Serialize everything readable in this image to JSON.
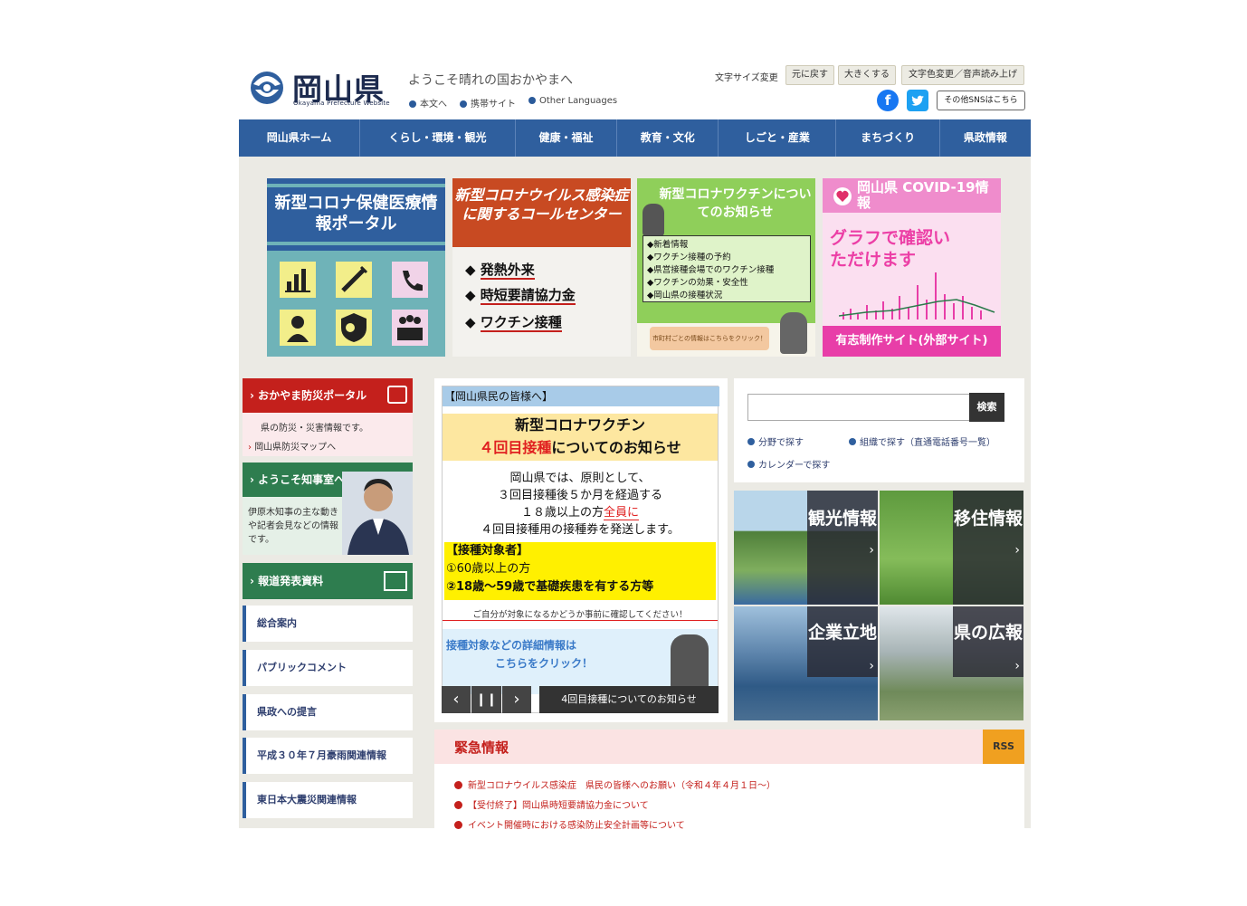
{
  "header": {
    "logo_text": "岡山県",
    "logo_sub": "Okayama Prefecture Website",
    "tagline": "ようこそ晴れの国おかやまへ",
    "links": [
      "本文へ",
      "携帯サイト",
      "Other Languages"
    ],
    "font_size_label": "文字サイズ変更",
    "font_reset": "元に戻す",
    "font_bigger": "大きくする",
    "color_voice": "文字色変更／音声読み上げ",
    "sns_other": "その他SNSはこちら"
  },
  "nav": [
    "岡山県ホーム",
    "くらし・環境・観光",
    "健康・福祉",
    "教育・文化",
    "しごと・産業",
    "まちづくり",
    "県政情報"
  ],
  "banners": {
    "b1_title": "新型コロナ保健医療情報ポータル",
    "b2_title": "新型コロナウイルス感染症に関するコールセンター",
    "b2_items": [
      "発熱外来",
      "時短要請協力金",
      "ワクチン接種"
    ],
    "b3_title": "新型コロナワクチンについてのお知らせ",
    "b3_items": [
      "◆新着情報",
      "◆ワクチン接種の予約",
      "◆県営接種会場でのワクチン接種",
      "◆ワクチンの効果・安全性",
      "◆岡山県の接種状況"
    ],
    "b3_footer": "市町村ごとの情報はこちらをクリック！",
    "b4_title": "岡山県 COVID-19情報",
    "b4_body": "グラフで確認いただけます",
    "b4_footer": "有志制作サイト(外部サイト)"
  },
  "left": {
    "bousai_title": "おかやま防災ポータル",
    "bousai_desc": "県の防災・災害情報です。",
    "bousai_link": "岡山県防災マップへ",
    "chiji_title": "ようこそ知事室へ",
    "chiji_desc": "伊原木知事の主な動きや記者会見などの情報です。",
    "press_title": "報道発表資料",
    "links": [
      "総合案内",
      "パブリックコメント",
      "県政への提言",
      "平成３０年７月豪雨関連情報",
      "東日本大震災関連情報"
    ]
  },
  "slide": {
    "header": "【岡山県民の皆様へ】",
    "title1": "新型コロナワクチン",
    "title2a": "４回目接種",
    "title2b": "についてのお知らせ",
    "body": [
      "岡山県では、原則として、",
      "３回目接種後５か月を経過する",
      "１８歳以上の方",
      "全員に",
      "４回目接種用の接種券を発送します。"
    ],
    "target_head": "【接種対象者】",
    "target1": "①60歳以上の方",
    "target2": "②18歳～59歳で基礎疾患を有する方等",
    "note": "ご自分が対象になるかどうか事前に確認してください！",
    "click1": "接種対象などの詳細情報は",
    "click2": "こちらをクリック！",
    "caption": "4回目接種についてのお知らせ"
  },
  "search": {
    "button": "検索",
    "placeholder": "",
    "link1": "分野で探す",
    "link2": "組織で探す（直通電話番号一覧）",
    "link3": "カレンダーで探す"
  },
  "tiles": [
    "観光情報",
    "移住情報",
    "企業立地",
    "県の広報"
  ],
  "emergency": {
    "title": "緊急情報",
    "rss": "RSS",
    "items": [
      "新型コロナウイルス感染症　県民の皆様へのお願い（令和４年４月１日～）",
      "【受付終了】岡山県時短要請協力金について",
      "イベント開催時における感染防止安全計画等について"
    ]
  },
  "colors": {
    "nav": "#2f5f9e",
    "red": "#c4201c",
    "green": "#2e7d4f"
  }
}
